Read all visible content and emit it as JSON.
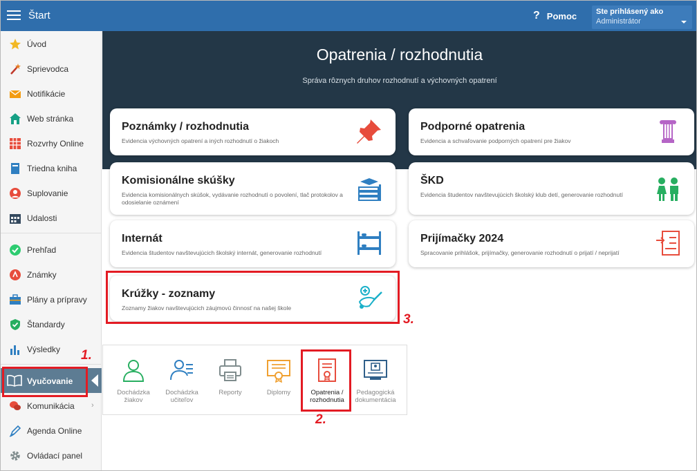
{
  "topbar": {
    "title": "Štart",
    "help_label": "Pomoc",
    "user_label": "Ste prihlásený ako",
    "user_value": "Administrátor"
  },
  "sidebar": {
    "items": [
      {
        "label": "Úvod"
      },
      {
        "label": "Sprievodca"
      },
      {
        "label": "Notifikácie"
      },
      {
        "label": "Web stránka"
      },
      {
        "label": "Rozvrhy Online"
      },
      {
        "label": "Triedna kniha"
      },
      {
        "label": "Suplovanie"
      },
      {
        "label": "Udalosti"
      },
      {
        "label": "Prehľad"
      },
      {
        "label": "Známky"
      },
      {
        "label": "Plány a prípravy"
      },
      {
        "label": "Štandardy"
      },
      {
        "label": "Výsledky"
      },
      {
        "label": "Vyučovanie"
      },
      {
        "label": "Komunikácia"
      },
      {
        "label": "Agenda Online"
      },
      {
        "label": "Ovládací panel"
      }
    ]
  },
  "hero": {
    "title": "Opatrenia / rozhodnutia",
    "subtitle": "Správa rôznych druhov rozhodnutí a výchovných opatrení"
  },
  "cards": [
    {
      "title": "Poznámky / rozhodnutia",
      "desc": "Evidencia výchovných opatrení a iných rozhodnutí o žiakoch"
    },
    {
      "title": "Podporné opatrenia",
      "desc": "Evidencia a schvaľovanie podporných opatrení pre žiakov"
    },
    {
      "title": "Komisionálne skúšky",
      "desc": "Evidencia komisionálnych skúšok, vydávanie rozhodnutí o povolení, tlač protokolov a odosielanie oznámení"
    },
    {
      "title": "ŠKD",
      "desc": "Evidencia študentov navštevujúcich školský klub detí, generovanie rozhodnutí"
    },
    {
      "title": "Internát",
      "desc": "Evidencia študentov navštevujúcich školský internát, generovanie rozhodnutí"
    },
    {
      "title": "Prijímačky 2024",
      "desc": "Spracovanie prihlášok, prijímačky, generovanie rozhodnutí o prijatí / neprijatí"
    },
    {
      "title": "Krúžky - zoznamy",
      "desc": "Zoznamy žiakov navštevujúcich záujmovú činnosť na našej škole"
    }
  ],
  "popup": {
    "items": [
      {
        "line1": "Dochádzka",
        "line2": "žiakov"
      },
      {
        "line1": "Dochádzka",
        "line2": "učiteľov"
      },
      {
        "line1": "Reporty",
        "line2": ""
      },
      {
        "line1": "Diplomy",
        "line2": ""
      },
      {
        "line1": "Opatrenia /",
        "line2": "rozhodnutia"
      },
      {
        "line1": "Pedagogická",
        "line2": "dokumentácia"
      }
    ]
  },
  "annotations": {
    "n1": "1.",
    "n2": "2.",
    "n3": "3."
  },
  "colors": {
    "topbar": "#2f6eac",
    "hero": "#233747",
    "active_sidebar": "#5d7c93",
    "annotation": "#e31b23"
  }
}
